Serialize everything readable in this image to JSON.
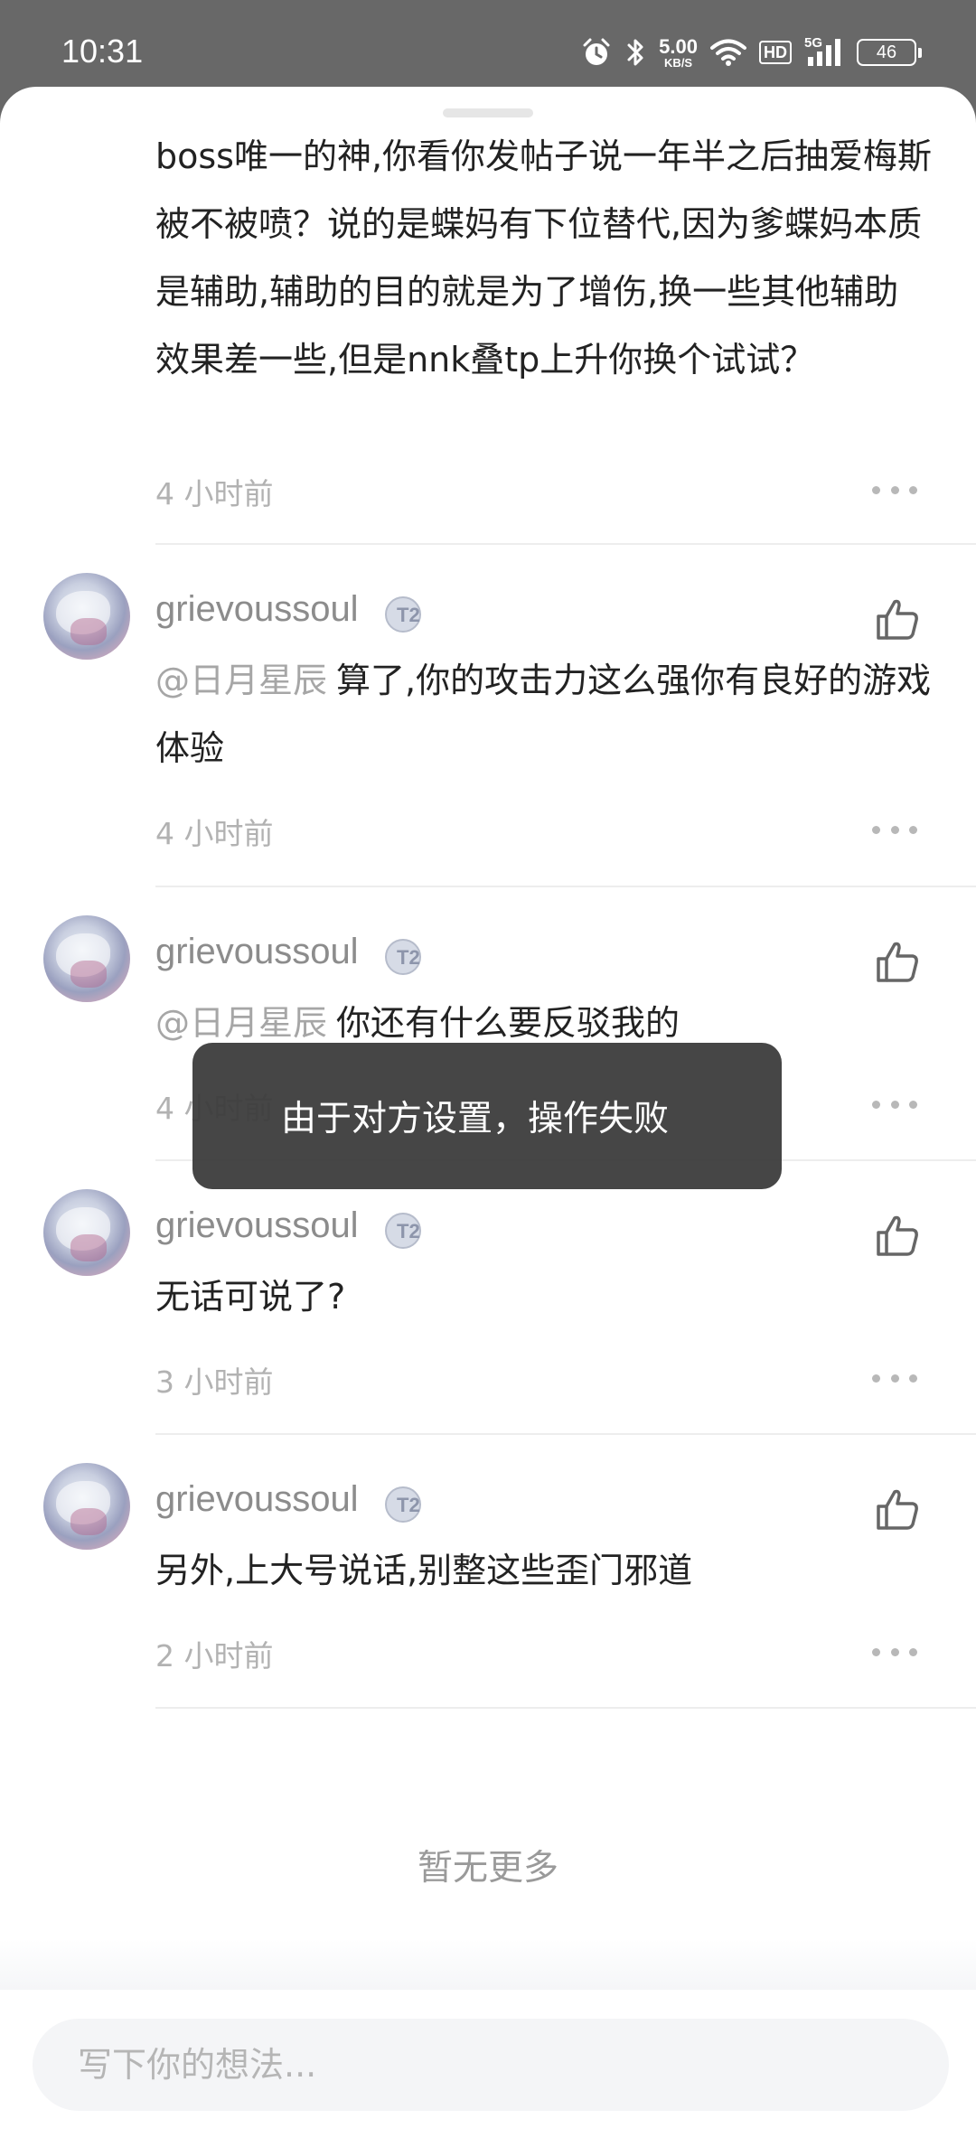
{
  "status_bar": {
    "time": "10:31",
    "net_speed_value": "5.00",
    "net_speed_unit": "KB/S",
    "hd_label": "HD",
    "signal_label": "5G",
    "battery_level": "46",
    "icons": [
      "alarm-icon",
      "bluetooth-icon",
      "wifi-icon",
      "signal-icon",
      "battery-icon"
    ]
  },
  "top_comment": {
    "text": "boss唯一的神,你看你发帖子说一年半之后抽爱梅斯被不被喷？说的是蝶妈有下位替代,因为爹蝶妈本质是辅助,辅助的目的就是为了增伤,换一些其他辅助效果差一些,但是nnk叠tp上升你换个试试？",
    "time": "4 小时前"
  },
  "comments": [
    {
      "username": "grievoussoul",
      "badge": "T2",
      "mention": "@日月星辰",
      "text": "算了,你的攻击力这么强你有良好的游戏体验",
      "time": "4 小时前"
    },
    {
      "username": "grievoussoul",
      "badge": "T2",
      "mention": "@日月星辰",
      "text": "你还有什么要反驳我的",
      "time": "4 小时前"
    },
    {
      "username": "grievoussoul",
      "badge": "T2",
      "mention": "",
      "text": "无话可说了?",
      "time": "3 小时前"
    },
    {
      "username": "grievoussoul",
      "badge": "T2",
      "mention": "",
      "text": "另外,上大号说话,别整这些歪门邪道",
      "time": "2 小时前"
    }
  ],
  "no_more_label": "暂无更多",
  "input": {
    "placeholder": "写下你的想法..."
  },
  "toast": {
    "message": "由于对方设置，操作失败"
  },
  "colors": {
    "status_bar_bg": "#686868",
    "text_primary": "#222222",
    "text_secondary": "#8c8c8c",
    "time_text": "#b2b2b2",
    "toast_bg": "#3c3c3c"
  }
}
